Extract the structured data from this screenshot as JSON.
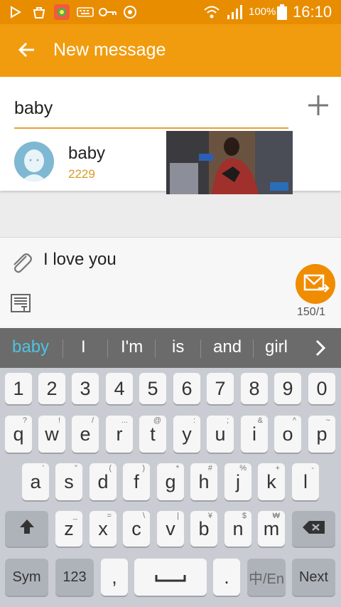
{
  "status_bar": {
    "battery": "100%",
    "time": "16:10"
  },
  "app_bar": {
    "title": "New message"
  },
  "recipient": {
    "value": "baby"
  },
  "suggestion": {
    "name": "baby",
    "number": "2229"
  },
  "compose": {
    "message": "I love you",
    "counter": "150/1"
  },
  "predictions": [
    "baby",
    "I",
    "I'm",
    "is",
    "and",
    "girl"
  ],
  "keyboard": {
    "number_row": [
      "1",
      "2",
      "3",
      "4",
      "5",
      "6",
      "7",
      "8",
      "9",
      "0"
    ],
    "row1": [
      {
        "label": "q",
        "hint": "?"
      },
      {
        "label": "w",
        "hint": "!"
      },
      {
        "label": "e",
        "hint": "/"
      },
      {
        "label": "r",
        "hint": "..."
      },
      {
        "label": "t",
        "hint": "@"
      },
      {
        "label": "y",
        "hint": ":"
      },
      {
        "label": "u",
        "hint": ";"
      },
      {
        "label": "i",
        "hint": "&"
      },
      {
        "label": "o",
        "hint": "^"
      },
      {
        "label": "p",
        "hint": "~"
      }
    ],
    "row2": [
      {
        "label": "a",
        "hint": "'"
      },
      {
        "label": "s",
        "hint": "\""
      },
      {
        "label": "d",
        "hint": "("
      },
      {
        "label": "f",
        "hint": ")"
      },
      {
        "label": "g",
        "hint": "*"
      },
      {
        "label": "h",
        "hint": "#"
      },
      {
        "label": "j",
        "hint": "%"
      },
      {
        "label": "k",
        "hint": "+"
      },
      {
        "label": "l",
        "hint": "-"
      }
    ],
    "row3": [
      {
        "label": "z",
        "hint": "_"
      },
      {
        "label": "x",
        "hint": "="
      },
      {
        "label": "c",
        "hint": "\\"
      },
      {
        "label": "v",
        "hint": "|"
      },
      {
        "label": "b",
        "hint": "¥"
      },
      {
        "label": "n",
        "hint": "$"
      },
      {
        "label": "m",
        "hint": "₩"
      }
    ],
    "bottom": {
      "sym": "Sym",
      "num": "123",
      "comma": ",",
      "period": ".",
      "lang": "中/En",
      "next": "Next"
    }
  }
}
